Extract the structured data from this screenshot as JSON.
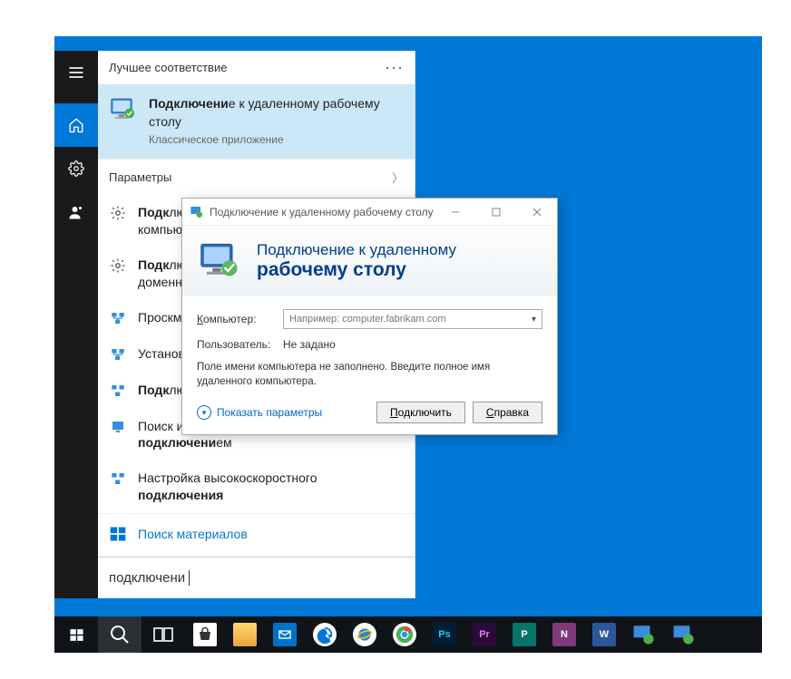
{
  "search": {
    "header": "Лучшее соответствие",
    "more": "···",
    "best": {
      "line1_pre": "Подключени",
      "line1_post": "е к удаленному рабочему столу",
      "subtitle": "Классическое приложение"
    },
    "params_header": "Параметры",
    "items": [
      {
        "pre": "Подк",
        "mid": "лючение виртуальной сети к компьютеру",
        "bold_start": true
      },
      {
        "pre": "Подк",
        "mid": "лючение к рабочему месту или доменной сети",
        "bold_start": true
      },
      {
        "pre": "Проск",
        "mid": "мотр сетевых ",
        "post": "подключений",
        "bold_end": true
      },
      {
        "pre": "Устан",
        "mid": "овка или изменение ",
        "post": "подключения",
        "bold_end": true
      },
      {
        "pre": "Подк",
        "mid": "лючение к удаленному рабочему столу",
        "bold_start": true
      },
      {
        "pre": "Поиск и устранение проблем с сетью и ",
        "post": "подключени",
        "tail": "ем",
        "bold_mid": true
      },
      {
        "pre": "Настройка высокоскоростного ",
        "post": "подключения",
        "bold_end": true
      }
    ],
    "store": "Поиск материалов",
    "input_value": "подключени"
  },
  "rdp": {
    "title": "Подключение к удаленному рабочему столу",
    "banner_l1": "Подключение к удаленному",
    "banner_l2": "рабочему столу",
    "computer_label": "Компьютер:",
    "computer_placeholder": "Например: computer.fabrikam.com",
    "user_label": "Пользователь:",
    "user_value": "Не задано",
    "hint": "Поле имени компьютера не заполнено. Введите полное имя удаленного компьютера.",
    "show_opts": "Показать параметры",
    "connect": "Подключить",
    "help": "Справка"
  },
  "taskbar": {
    "apps": [
      "store",
      "folder",
      "mail",
      "edge",
      "ie",
      "chrome",
      "ps",
      "pr",
      "pub",
      "onenote",
      "word",
      "rdp1",
      "rdp2"
    ]
  }
}
